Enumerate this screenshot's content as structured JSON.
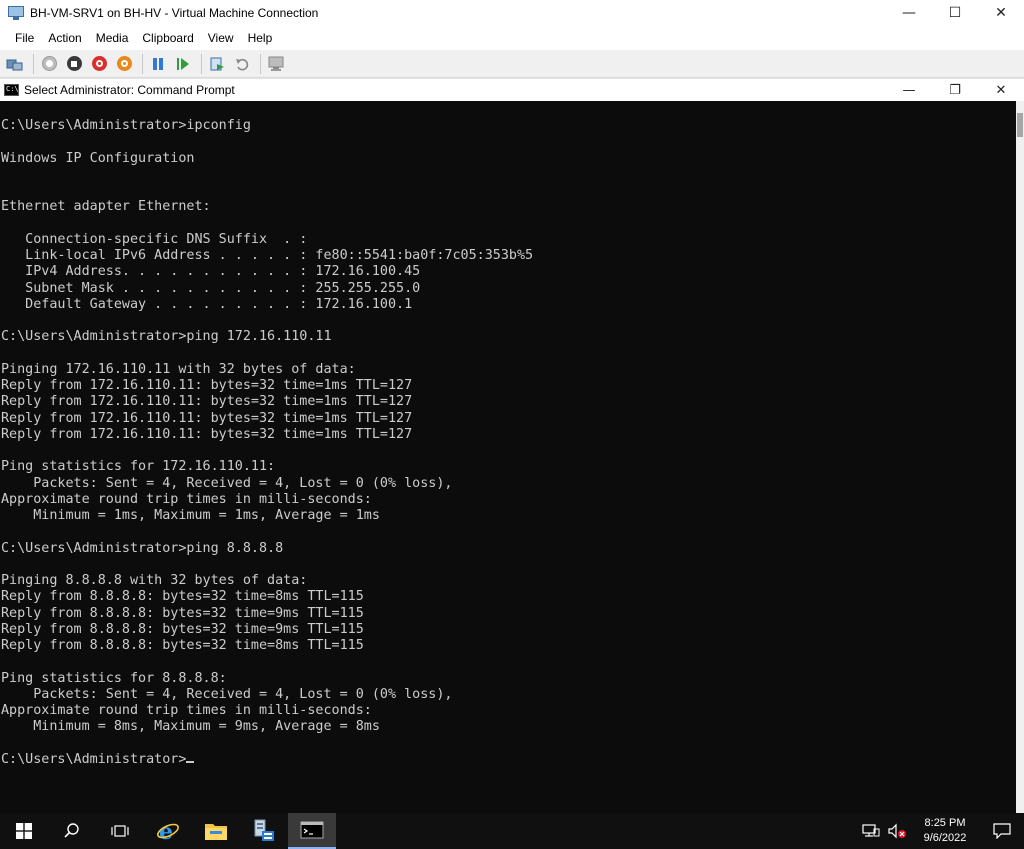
{
  "vm_window": {
    "title": "BH-VM-SRV1 on BH-HV - Virtual Machine Connection",
    "menu": [
      "File",
      "Action",
      "Media",
      "Clipboard",
      "View",
      "Help"
    ],
    "controls": {
      "minimize": "—",
      "maximize": "☐",
      "close": "✕"
    }
  },
  "toolbar": {
    "icons": [
      "ctrl-alt-del-icon",
      "start-icon",
      "turn-off-icon",
      "shutdown-icon",
      "save-icon",
      "pause-icon",
      "resume-icon",
      "checkpoint-icon",
      "revert-icon",
      "enhanced-session-icon"
    ]
  },
  "cmd_window": {
    "title": "Select Administrator: Command Prompt",
    "controls": {
      "minimize": "—",
      "restore": "❐",
      "close": "✕"
    }
  },
  "console": {
    "lines": [
      "C:\\Users\\Administrator>ipconfig",
      "",
      "Windows IP Configuration",
      "",
      "",
      "Ethernet adapter Ethernet:",
      "",
      "   Connection-specific DNS Suffix  . :",
      "   Link-local IPv6 Address . . . . . : fe80::5541:ba0f:7c05:353b%5",
      "   IPv4 Address. . . . . . . . . . . : 172.16.100.45",
      "   Subnet Mask . . . . . . . . . . . : 255.255.255.0",
      "   Default Gateway . . . . . . . . . : 172.16.100.1",
      "",
      "C:\\Users\\Administrator>ping 172.16.110.11",
      "",
      "Pinging 172.16.110.11 with 32 bytes of data:",
      "Reply from 172.16.110.11: bytes=32 time=1ms TTL=127",
      "Reply from 172.16.110.11: bytes=32 time=1ms TTL=127",
      "Reply from 172.16.110.11: bytes=32 time=1ms TTL=127",
      "Reply from 172.16.110.11: bytes=32 time=1ms TTL=127",
      "",
      "Ping statistics for 172.16.110.11:",
      "    Packets: Sent = 4, Received = 4, Lost = 0 (0% loss),",
      "Approximate round trip times in milli-seconds:",
      "    Minimum = 1ms, Maximum = 1ms, Average = 1ms",
      "",
      "C:\\Users\\Administrator>ping 8.8.8.8",
      "",
      "Pinging 8.8.8.8 with 32 bytes of data:",
      "Reply from 8.8.8.8: bytes=32 time=8ms TTL=115",
      "Reply from 8.8.8.8: bytes=32 time=9ms TTL=115",
      "Reply from 8.8.8.8: bytes=32 time=9ms TTL=115",
      "Reply from 8.8.8.8: bytes=32 time=8ms TTL=115",
      "",
      "Ping statistics for 8.8.8.8:",
      "    Packets: Sent = 4, Received = 4, Lost = 0 (0% loss),",
      "Approximate round trip times in milli-seconds:",
      "    Minimum = 8ms, Maximum = 9ms, Average = 8ms",
      "",
      "C:\\Users\\Administrator>"
    ]
  },
  "taskbar": {
    "apps": [
      "windows-start-icon",
      "search-icon",
      "task-view-icon",
      "internet-explorer-icon",
      "file-explorer-icon",
      "server-manager-icon",
      "command-prompt-icon"
    ],
    "clock": {
      "time": "8:25 PM",
      "date": "9/6/2022"
    }
  }
}
